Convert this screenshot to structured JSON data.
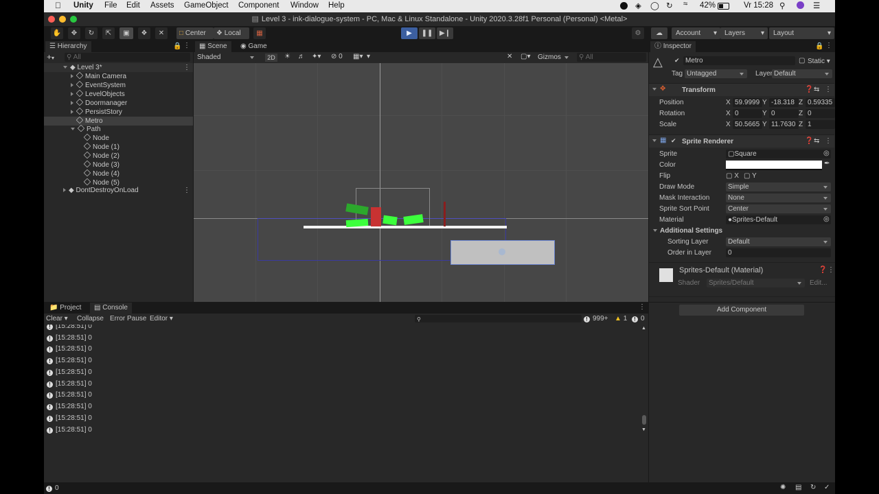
{
  "menubar": {
    "app": "Unity",
    "items": [
      "File",
      "Edit",
      "Assets",
      "GameObject",
      "Component",
      "Window",
      "Help"
    ],
    "battery": "42%",
    "clock": "Vr 15:28"
  },
  "window": {
    "title": "Level 3 - ink-dialogue-system - PC, Mac & Linux Standalone - Unity 2020.3.28f1 Personal (Personal) <Metal>"
  },
  "toolbar": {
    "pivot": "Center",
    "space": "Local",
    "account": "Account",
    "layers": "Layers",
    "layout": "Layout"
  },
  "hierarchy": {
    "tab": "Hierarchy",
    "search_placeholder": "All",
    "scene": "Level 3*",
    "items": [
      {
        "label": "Main Camera",
        "indent": 1,
        "arrow": true
      },
      {
        "label": "EventSystem",
        "indent": 1,
        "arrow": true
      },
      {
        "label": "LevelObjects",
        "indent": 1,
        "arrow": true
      },
      {
        "label": "Doormanager",
        "indent": 1,
        "arrow": true
      },
      {
        "label": "PersistStory",
        "indent": 1,
        "arrow": true
      },
      {
        "label": "Metro",
        "indent": 1,
        "arrow": false,
        "selected": true
      },
      {
        "label": "Path",
        "indent": 1,
        "arrow": "open"
      },
      {
        "label": "Node",
        "indent": 2,
        "arrow": false
      },
      {
        "label": "Node (1)",
        "indent": 2,
        "arrow": false
      },
      {
        "label": "Node (2)",
        "indent": 2,
        "arrow": false
      },
      {
        "label": "Node (3)",
        "indent": 2,
        "arrow": false
      },
      {
        "label": "Node (4)",
        "indent": 2,
        "arrow": false
      },
      {
        "label": "Node (5)",
        "indent": 2,
        "arrow": false
      }
    ],
    "dont_destroy": "DontDestroyOnLoad"
  },
  "scene_view": {
    "tabs": [
      "Scene",
      "Game"
    ],
    "shading": "Shaded",
    "mode_2d": "2D",
    "hidden_count": "0",
    "gizmos": "Gizmos",
    "search_placeholder": "All"
  },
  "console": {
    "tabs": [
      "Project",
      "Console"
    ],
    "clear": "Clear",
    "collapse": "Collapse",
    "error_pause": "Error Pause",
    "editor": "Editor",
    "log_count": "999+",
    "warn_count": "1",
    "error_count": "0",
    "partial_top": "[15:28:51] 0",
    "entries": [
      "[15:28:51] 0",
      "[15:28:51] 0",
      "[15:28:51] 0",
      "[15:28:51] 0",
      "[15:28:51] 0",
      "[15:28:51] 0",
      "[15:28:51] 0",
      "[15:28:51] 0",
      "[15:28:51] 0"
    ]
  },
  "inspector": {
    "tab": "Inspector",
    "object_name": "Metro",
    "static": "Static",
    "tag_label": "Tag",
    "tag": "Untagged",
    "layer_label": "Layer",
    "layer": "Default",
    "transform": {
      "title": "Transform",
      "position_label": "Position",
      "rotation_label": "Rotation",
      "scale_label": "Scale",
      "axis_x": "X",
      "axis_y": "Y",
      "axis_z": "Z",
      "position": {
        "x": "59.9999",
        "y": "-18.318",
        "z": "0.59335"
      },
      "rotation": {
        "x": "0",
        "y": "0",
        "z": "0"
      },
      "scale": {
        "x": "50.5665",
        "y": "11.7630",
        "z": "1"
      }
    },
    "sprite_renderer": {
      "title": "Sprite Renderer",
      "sprite_label": "Sprite",
      "sprite": "Square",
      "color_label": "Color",
      "flip_label": "Flip",
      "flip_x": "X",
      "flip_y": "Y",
      "draw_mode_label": "Draw Mode",
      "draw_mode": "Simple",
      "mask_label": "Mask Interaction",
      "mask": "None",
      "sort_point_label": "Sprite Sort Point",
      "sort_point": "Center",
      "material_label": "Material",
      "material": "Sprites-Default",
      "additional": "Additional Settings",
      "sorting_layer_label": "Sorting Layer",
      "sorting_layer": "Default",
      "order_label": "Order in Layer",
      "order": "0"
    },
    "material": {
      "title": "Sprites-Default (Material)",
      "shader_label": "Shader",
      "shader": "Sprites/Default",
      "edit": "Edit..."
    },
    "add_component": "Add Component"
  },
  "statusbar": {
    "count": "0"
  },
  "colors": {
    "play_active": "#3c5fa0",
    "selection": "#3e3e3e",
    "green_sprite": "#3cff3c",
    "red_sprite": "#c83232"
  }
}
